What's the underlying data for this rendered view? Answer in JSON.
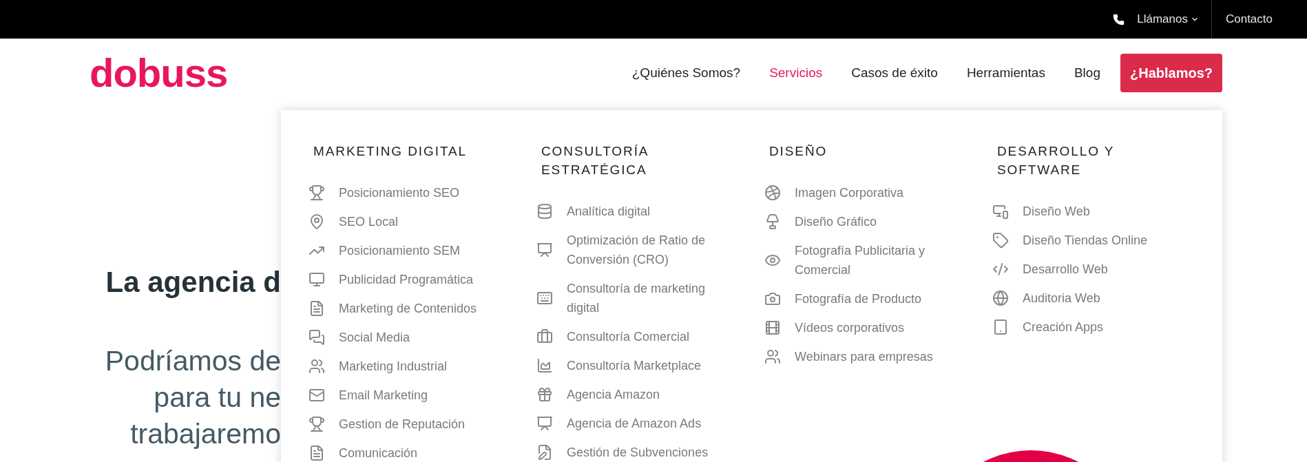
{
  "top_bar": {
    "phone_menu": {
      "label": "Llámanos"
    },
    "contact_link": "Contacto"
  },
  "header": {
    "logo": "dobuss",
    "nav": [
      {
        "label": "¿Quiénes Somos?",
        "selected": false
      },
      {
        "label": "Servicios",
        "selected": true
      },
      {
        "label": "Casos de éxito",
        "selected": false
      },
      {
        "label": "Herramientas",
        "selected": false
      },
      {
        "label": "Blog",
        "selected": false
      }
    ],
    "cta_button": "¿Hablamos?"
  },
  "hero": {
    "heading": "La agencia d",
    "lines": [
      "Podríamos de",
      "para tu ne",
      "trabajaremo"
    ]
  },
  "mega_menu": {
    "columns": [
      {
        "heading": "MARKETING DIGITAL",
        "items": [
          {
            "label": "Posicionamiento SEO"
          },
          {
            "label": "SEO Local"
          },
          {
            "label": "Posicionamiento SEM"
          },
          {
            "label": "Publicidad Programática"
          },
          {
            "label": "Marketing de Contenidos"
          },
          {
            "label": "Social Media"
          },
          {
            "label": "Marketing Industrial"
          },
          {
            "label": "Email Marketing"
          },
          {
            "label": "Gestion de Reputación"
          },
          {
            "label": "Comunicación"
          }
        ]
      },
      {
        "heading": "CONSULTORÍA ESTRATÉGICA",
        "items": [
          {
            "label": "Analítica digital"
          },
          {
            "label": "Optimización de Ratio de Conversión (CRO)"
          },
          {
            "label": "Consultoría de marketing digital"
          },
          {
            "label": "Consultoría Comercial"
          },
          {
            "label": "Consultoría Marketplace"
          },
          {
            "label": "Agencia Amazon"
          },
          {
            "label": "Agencia de Amazon Ads"
          },
          {
            "label": "Gestión de Subvenciones"
          }
        ]
      },
      {
        "heading": "DISEÑO",
        "items": [
          {
            "label": "Imagen Corporativa"
          },
          {
            "label": "Diseño Gráfico"
          },
          {
            "label": "Fotografía Publicitaria y Comercial"
          },
          {
            "label": "Fotografía de Producto"
          },
          {
            "label": "Vídeos corporativos"
          },
          {
            "label": "Webinars para empresas"
          }
        ]
      },
      {
        "heading": "DESARROLLO Y SOFTWARE",
        "items": [
          {
            "label": "Diseño Web"
          },
          {
            "label": "Diseño Tiendas Online"
          },
          {
            "label": "Desarrollo Web"
          },
          {
            "label": "Auditoria Web"
          },
          {
            "label": "Creación Apps"
          }
        ]
      }
    ]
  }
}
